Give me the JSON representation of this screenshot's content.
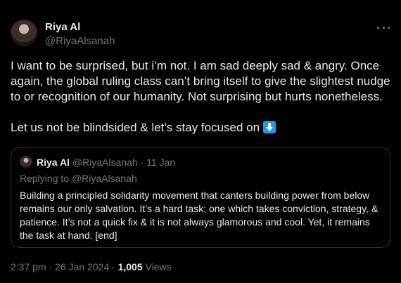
{
  "author": {
    "display_name": "Riya Al",
    "handle": "@RiyaAlsanah"
  },
  "tweet": {
    "paragraph1": "I want to be surprised, but i’m not. I am sad deeply sad & angry. Once again, the global ruling class can’t bring itself to give the slightest nudge to or recognition of our humanity. Not surprising but hurts nonetheless.",
    "paragraph2": "Let us not be blindsided & let’s stay focused on",
    "emoji": "down-arrow-emoji"
  },
  "quoted_tweet": {
    "display_name": "Riya Al",
    "handle": "@RiyaAlsanah",
    "separator": "·",
    "date": "11 Jan",
    "replying_prefix": "Replying to",
    "replying_to": "@RiyaAlsanah",
    "text": "Building a principled solidarity movement that canters building power from below remains our only salvation. It’s a hard task; one which takes conviction, strategy, & patience. It’s not a quick fix & it is not always glamorous and cool. Yet, it remains the task at hand. [end]"
  },
  "meta": {
    "time": "2:37 pm",
    "separator1": "·",
    "date": "26 Jan 2024",
    "separator2": "·",
    "views_count": "1,005",
    "views_label": "Views"
  },
  "colors": {
    "background": "#000000",
    "text": "#e7e9ea",
    "secondary": "#71767b",
    "border": "#2f3336",
    "emoji_bg": "#1d9bf0"
  },
  "icons": {
    "more": "more-horizontal-icon"
  }
}
